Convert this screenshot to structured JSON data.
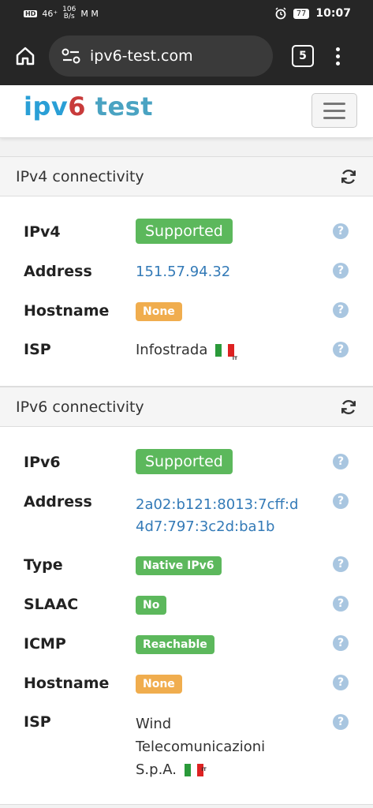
{
  "status_bar": {
    "hd": "HD",
    "signal": "46⁺",
    "net_speed_top": "106",
    "net_speed_bottom": "B/s",
    "notif_icons": "M M",
    "battery": "77",
    "time": "10:07"
  },
  "browser": {
    "url": "ipv6-test.com",
    "tab_count": "5"
  },
  "site": {
    "logo_ipv": "ipv",
    "logo_six": "6",
    "logo_test": " test"
  },
  "ipv4": {
    "title": "IPv4 connectivity",
    "rows": {
      "ipv4": {
        "label": "IPv4",
        "value": "Supported"
      },
      "address": {
        "label": "Address",
        "value": "151.57.94.32"
      },
      "hostname": {
        "label": "Hostname",
        "value": "None"
      },
      "isp": {
        "label": "ISP",
        "value": "Infostrada",
        "flag_code": "IT"
      }
    }
  },
  "ipv6": {
    "title": "IPv6 connectivity",
    "rows": {
      "ipv6": {
        "label": "IPv6",
        "value": "Supported"
      },
      "address": {
        "label": "Address",
        "value_line1": "2a02:b121:8013:7cff:d",
        "value_line2": "4d7:797:3c2d:ba1b"
      },
      "type": {
        "label": "Type",
        "value": "Native IPv6"
      },
      "slaac": {
        "label": "SLAAC",
        "value": "No"
      },
      "icmp": {
        "label": "ICMP",
        "value": "Reachable"
      },
      "hostname": {
        "label": "Hostname",
        "value": "None"
      },
      "isp": {
        "label": "ISP",
        "value_line1": "Wind",
        "value_line2": "Telecomunicazioni",
        "value_line3": "S.p.A.",
        "flag_code": "IT"
      }
    }
  },
  "help_symbol": "?"
}
